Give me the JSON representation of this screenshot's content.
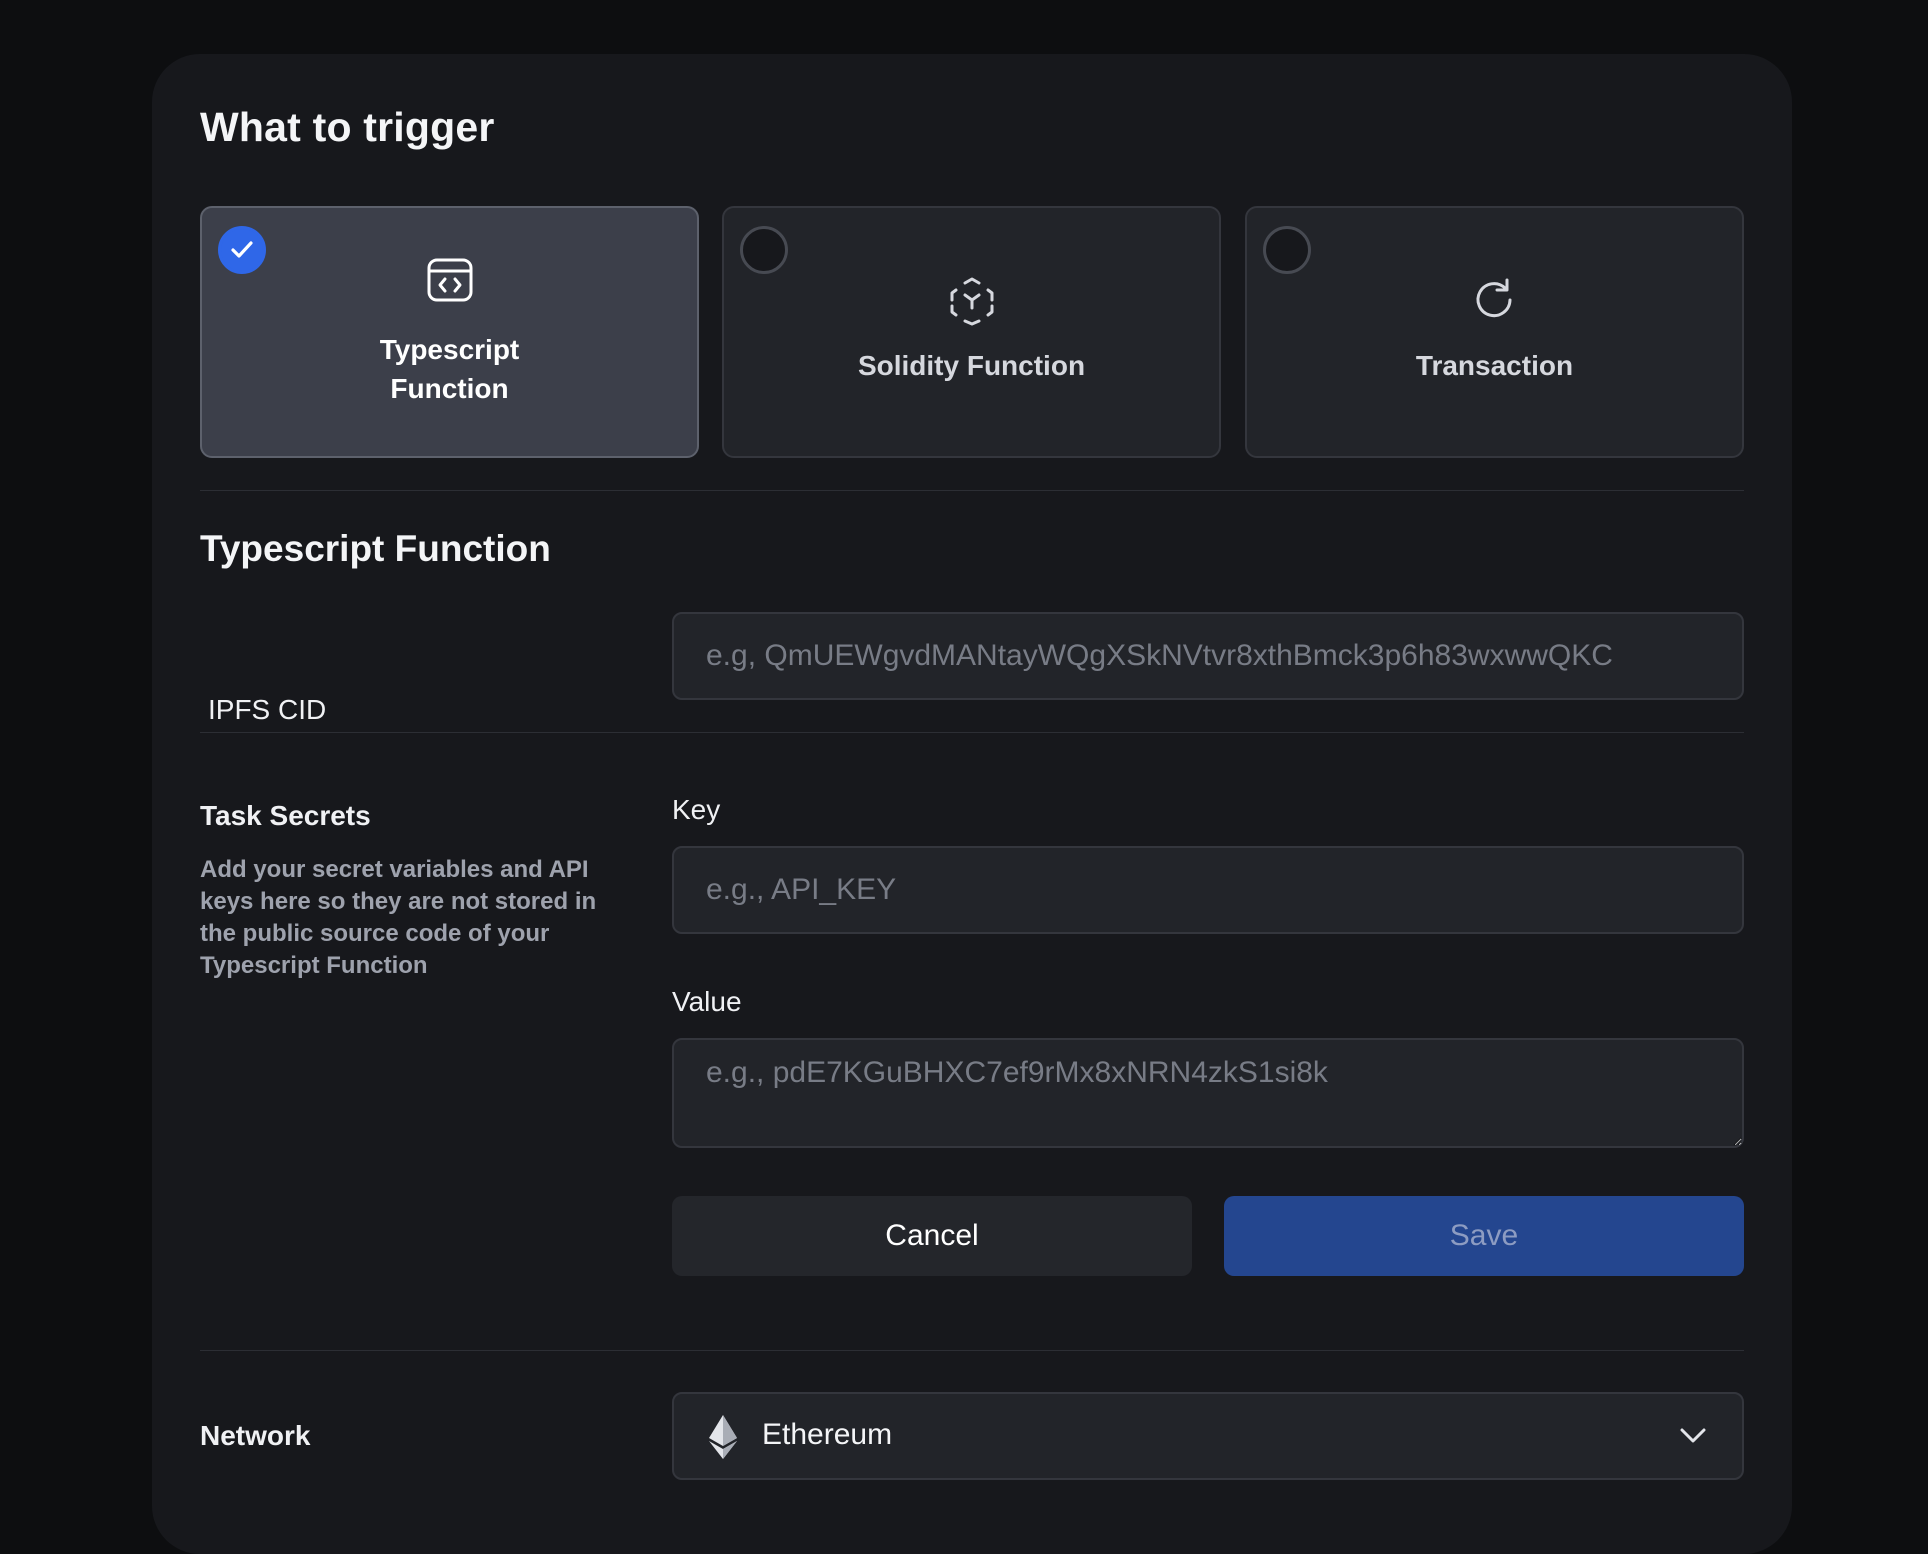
{
  "page": {
    "title": "What to trigger"
  },
  "trigger_options": [
    {
      "label": "Typescript Function",
      "icon": "code-window-icon",
      "selected": true
    },
    {
      "label": "Solidity Function",
      "icon": "scan-cube-icon",
      "selected": false
    },
    {
      "label": "Transaction",
      "icon": "refresh-icon",
      "selected": false
    }
  ],
  "section": {
    "title": "Typescript Function"
  },
  "ipfs": {
    "label": "IPFS CID",
    "placeholder": "e.g, QmUEWgvdMANtayWQgXSkNVtvr8xthBmck3p6h83wxwwQKC"
  },
  "secrets": {
    "title": "Task Secrets",
    "description": "Add your secret variables and API keys here so they are not stored in the public source code of your Typescript Function",
    "key_label": "Key",
    "key_placeholder": "e.g., API_KEY",
    "value_label": "Value",
    "value_placeholder": "e.g., pdE7KGuBHXC7ef9rMx8xNRN4zkS1si8k",
    "cancel_label": "Cancel",
    "save_label": "Save"
  },
  "network": {
    "label": "Network",
    "value": "Ethereum",
    "icon": "ethereum-icon"
  },
  "colors": {
    "accent": "#2f67e8",
    "save_button": "#24468f",
    "panel": "#17181c",
    "background": "#0d0e10"
  }
}
